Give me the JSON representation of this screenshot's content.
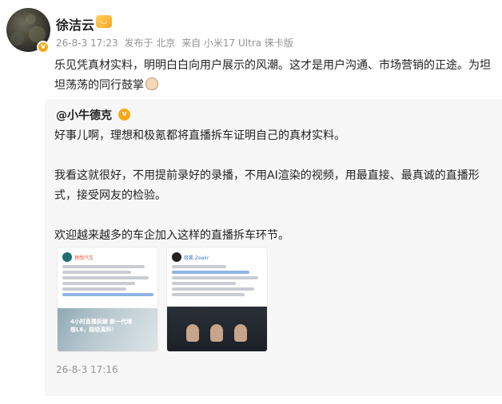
{
  "post": {
    "username": "徐洁云",
    "meta": {
      "time": "26-8-3 17:23",
      "location": "发布于 北京",
      "source": "来自 小米17 Ultra 徕卡版"
    },
    "text": "乐见凭真材实料，明明白白向用户展示的风潮。这才是用户沟通、市场营销的正途。为坦坦荡荡的同行鼓掌"
  },
  "retweet": {
    "author": "@小牛德克",
    "paragraphs": [
      "好事儿啊，理想和极氪都将直播拆车证明自己的真材实料。",
      "我看这就很好，不用提前录好的录播，不用AI渲染的视频，用最直接、最真诚的直播形式，接受网友的检验。",
      "欢迎越来越多的车企加入这样的直播拆车环节。"
    ],
    "time": "26-8-3 17:16",
    "images": [
      {
        "name": "理想汽车",
        "overlay": "4小时直播拆解 新一代理想L6，超级真料！"
      },
      {
        "name": "极氪 Zeekr"
      }
    ]
  },
  "icons": {
    "verified": "verified-badge-icon",
    "clap": "clap-icon",
    "user_tag": "user-tag-icon"
  },
  "colors": {
    "verified": "#f7a817",
    "meta": "#939393",
    "retweet_bg": "#f7f7f7"
  }
}
